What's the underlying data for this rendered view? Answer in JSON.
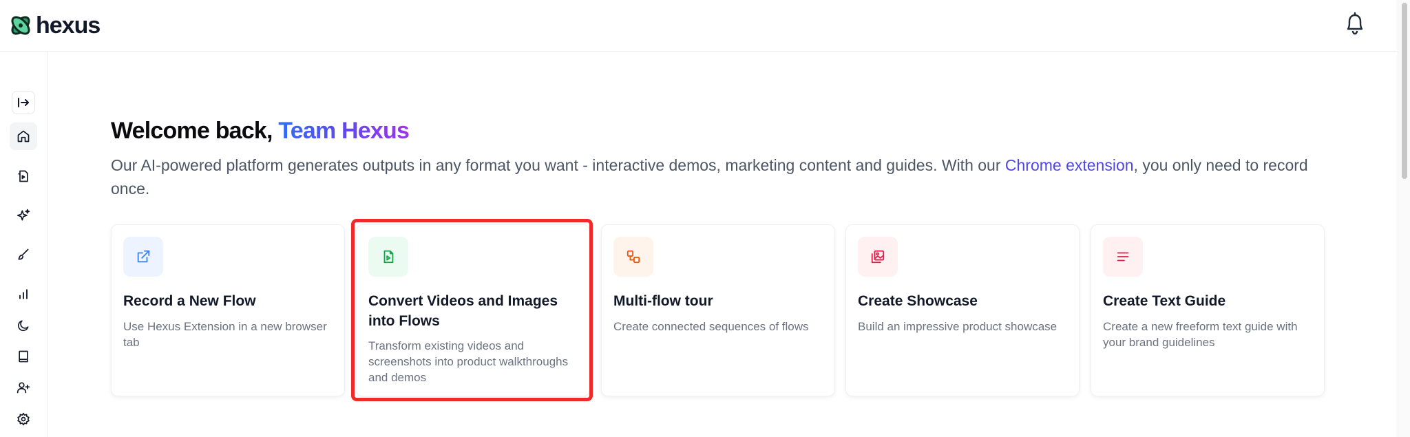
{
  "header": {
    "logo_text": "hexus"
  },
  "sidebar": {
    "items": [
      {
        "name": "home",
        "icon": "home-icon"
      },
      {
        "name": "flows",
        "icon": "document-video-icon"
      },
      {
        "name": "ai",
        "icon": "sparkles-icon"
      },
      {
        "name": "brush",
        "icon": "brush-icon"
      },
      {
        "name": "analytics",
        "icon": "bar-chart-icon"
      },
      {
        "name": "theme",
        "icon": "moon-icon"
      },
      {
        "name": "docs",
        "icon": "book-icon"
      },
      {
        "name": "invite",
        "icon": "user-plus-icon"
      },
      {
        "name": "settings",
        "icon": "gear-icon"
      }
    ]
  },
  "welcome": {
    "prefix": "Welcome back, ",
    "name": "Team Hexus"
  },
  "intro": {
    "text_before": "Our AI-powered platform generates outputs in any format you want - interactive demos, marketing content and guides. With our ",
    "link": "Chrome extension",
    "text_after": ", you only need to record once."
  },
  "cards": [
    {
      "title": "Record a New Flow",
      "description": "Use Hexus Extension in a new browser tab",
      "icon": "external-link-icon",
      "icon_color": "#3b82f6",
      "icon_bg": "#eef4ff"
    },
    {
      "title": "Convert Videos and Images into Flows",
      "description": "Transform existing videos and screenshots into product walkthroughs and demos",
      "icon": "file-video-icon",
      "icon_color": "#16a34a",
      "icon_bg": "#ecfbf1"
    },
    {
      "title": "Multi-flow tour",
      "description": "Create connected sequences of flows",
      "icon": "connected-squares-icon",
      "icon_color": "#ea580c",
      "icon_bg": "#fff4eb"
    },
    {
      "title": "Create Showcase",
      "description": "Build an impressive product showcase",
      "icon": "image-gallery-icon",
      "icon_color": "#e11d48",
      "icon_bg": "#fff0f2"
    },
    {
      "title": "Create Text Guide",
      "description": "Create a new freeform text guide with your brand guidelines",
      "icon": "text-lines-icon",
      "icon_color": "#e11d48",
      "icon_bg": "#fff0f2"
    }
  ],
  "colors": {
    "accent": "#4f46e5",
    "highlight_border": "#ee2a2a"
  }
}
